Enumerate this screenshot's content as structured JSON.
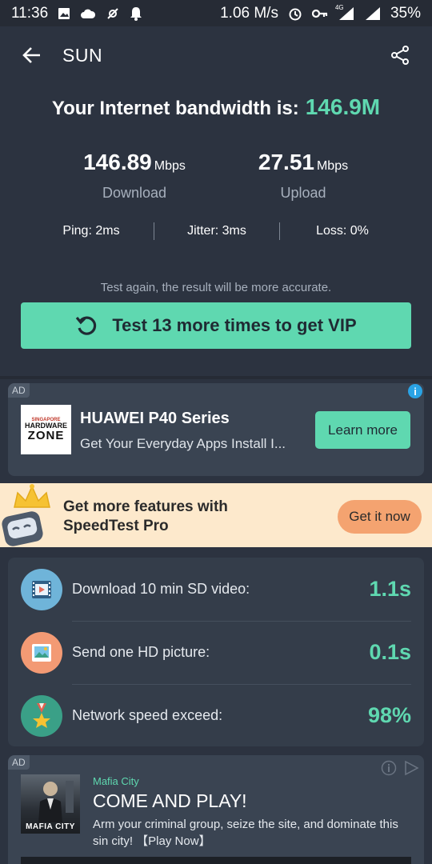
{
  "status_bar": {
    "time": "11:36",
    "net_speed": "1.06 M/s",
    "network_tag": "4G",
    "battery": "35%"
  },
  "app_bar": {
    "title": "SUN",
    "back_icon": "arrow-left-icon",
    "share_icon": "share-icon"
  },
  "result": {
    "headline": "Your Internet bandwidth is:",
    "bandwidth": "146.9M",
    "download_value": "146.89",
    "download_unit": "Mbps",
    "download_label": "Download",
    "upload_value": "27.51",
    "upload_unit": "Mbps",
    "upload_label": "Upload",
    "ping": "Ping: 2ms",
    "jitter": "Jitter: 3ms",
    "loss": "Loss: 0%"
  },
  "retest": {
    "hint": "Test again, the result will be more accurate.",
    "button_label": "Test 13 more times to get VIP"
  },
  "ad1": {
    "tag": "AD",
    "info": "i",
    "logo_line1": "SINGAPORE",
    "logo_line2": "HARDWARE",
    "logo_line3": "ZONE",
    "title": "HUAWEI P40 Series",
    "description": "Get Your Everyday Apps Install I...",
    "cta": "Learn more"
  },
  "pro_banner": {
    "line1": "Get more features with",
    "line2": "SpeedTest Pro",
    "cta": "Get it now"
  },
  "metrics": [
    {
      "label": "Download 10 min SD video:",
      "value": "1.1s",
      "icon": "video-film-icon",
      "color": "#6fb4d9"
    },
    {
      "label": "Send one HD picture:",
      "value": "0.1s",
      "icon": "picture-icon",
      "color": "#f39a74"
    },
    {
      "label": "Network speed exceed:",
      "value": "98%",
      "icon": "medal-icon",
      "color": "#3aa087"
    }
  ],
  "ad2": {
    "tag": "AD",
    "advertiser": "Mafia City",
    "poster_text": "MAFIA CITY",
    "title": "COME AND PLAY!",
    "description": "Arm your criminal group, seize the site, and dominate this sin city! 【Play Now】"
  },
  "colors": {
    "background": "#2c3340",
    "accent": "#5fd8b0",
    "card": "#3a4452",
    "banner": "#fde9cc",
    "banner_button": "#f4a370"
  }
}
